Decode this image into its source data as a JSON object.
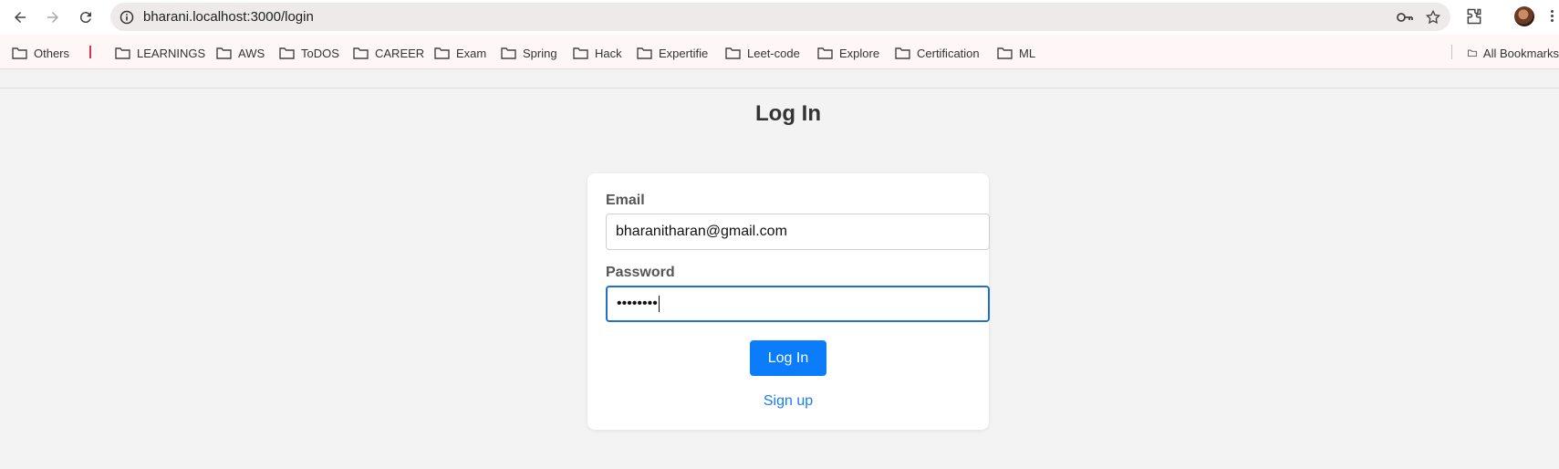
{
  "browser": {
    "url": "bharani.localhost:3000/login",
    "bookmarks": [
      {
        "label": "Others"
      },
      {
        "label": "LEARNINGS"
      },
      {
        "label": "AWS"
      },
      {
        "label": "ToDOS"
      },
      {
        "label": "CAREER"
      },
      {
        "label": "Exam"
      },
      {
        "label": "Spring"
      },
      {
        "label": "Hack"
      },
      {
        "label": "Expertifie"
      },
      {
        "label": "Leet-code"
      },
      {
        "label": "Explore"
      },
      {
        "label": "Certification"
      },
      {
        "label": "ML"
      }
    ],
    "all_bookmarks_label": "All Bookmarks"
  },
  "page": {
    "title": "Log In",
    "email_label": "Email",
    "email_value": "bharanitharan@gmail.com",
    "password_label": "Password",
    "password_value": "••••••••",
    "login_button": "Log In",
    "signup_link": "Sign up"
  },
  "colors": {
    "primary": "#0b7dfa",
    "link": "#1a7cf0",
    "focus_border": "#1f6fd1"
  }
}
